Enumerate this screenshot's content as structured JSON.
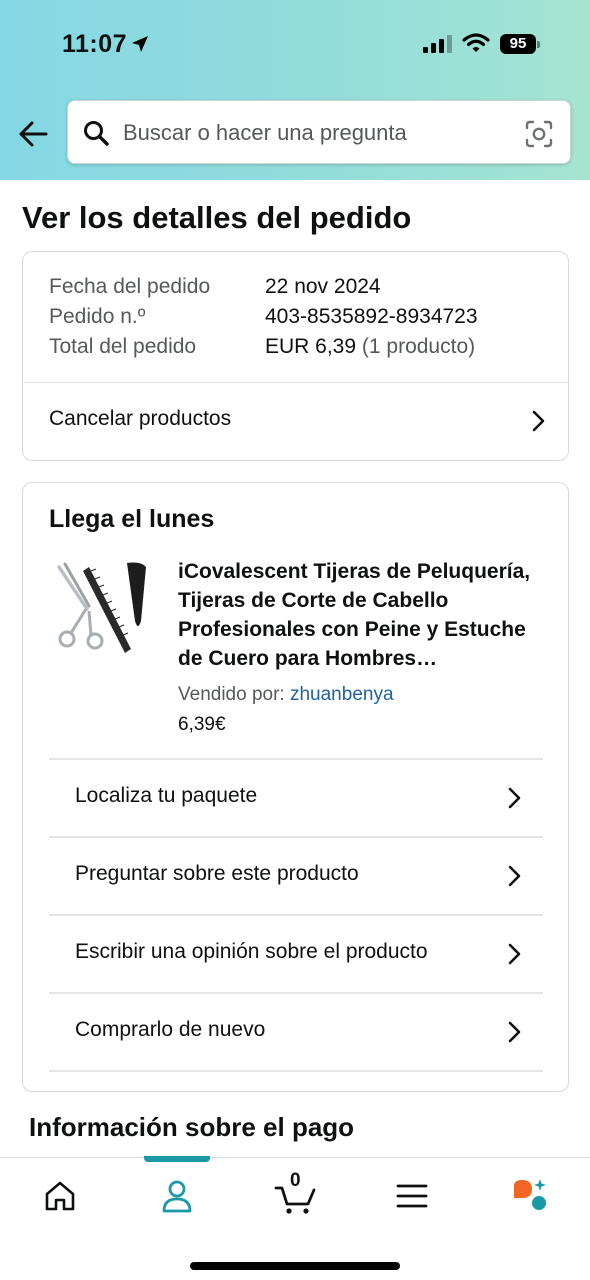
{
  "status_bar": {
    "time": "11:07",
    "battery": "95"
  },
  "search": {
    "placeholder": "Buscar o hacer una pregunta"
  },
  "page_title": "Ver los detalles del pedido",
  "order": {
    "date_label": "Fecha del pedido",
    "date_value": "22 nov 2024",
    "number_label": "Pedido n.º",
    "number_value": "403-8535892-8934723",
    "total_label": "Total del pedido",
    "total_value": "EUR 6,39",
    "total_count": "(1 producto)",
    "cancel_label": "Cancelar productos"
  },
  "shipment": {
    "arrival": "Llega el lunes",
    "product_title": "iCovalescent Tijeras de Peluquería, Tijeras de Corte de Cabello Profesionales con Peine y Estuche de Cuero para Hombres…",
    "sold_by_label": "Vendido por:",
    "seller": "zhuanbenya",
    "price": "6,39€",
    "actions": [
      {
        "label": "Localiza tu paquete"
      },
      {
        "label": "Preguntar sobre este producto"
      },
      {
        "label": "Escribir una opinión sobre el producto"
      },
      {
        "label": "Comprarlo de nuevo"
      }
    ]
  },
  "payment_section_title": "Información sobre el pago",
  "bottom_nav": {
    "items": [
      "home-icon",
      "account-icon",
      "cart-icon",
      "menu-icon",
      "rufus-icon"
    ],
    "active": "account-icon",
    "cart_count": "0"
  },
  "colors": {
    "accent": "#1a98a6",
    "link": "#2162a1",
    "header_start": "#84d8e3",
    "header_end": "#a6e4d0"
  }
}
